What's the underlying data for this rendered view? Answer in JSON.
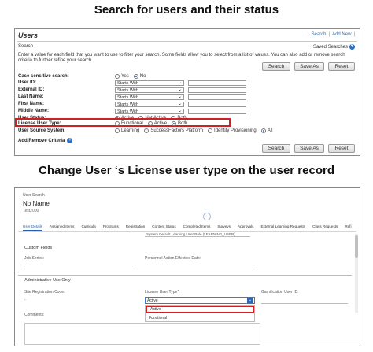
{
  "headings": {
    "top": "Search for users and their status",
    "bottom": "Change User ‘s License user type on the user record"
  },
  "panel1": {
    "title": "Users",
    "toplinks": [
      "Search",
      "Add New"
    ],
    "search_label": "Search",
    "saved_searches_label": "Saved Searches",
    "instructions": "Enter a value for each field that you want to use to filter your search. Some fields allow you to select from a list of values. You can also add or remove search criteria to further refine your search.",
    "buttons": {
      "search": "Search",
      "save_as": "Save As",
      "reset": "Reset"
    },
    "criteria": {
      "case_sensitive": {
        "label": "Case sensitive search:",
        "options": [
          "Yes",
          "No"
        ],
        "selected": "No"
      },
      "user_id": {
        "label": "User ID:",
        "operator": "Starts With"
      },
      "external_id": {
        "label": "External ID:",
        "operator": "Starts With"
      },
      "last_name": {
        "label": "Last Name:",
        "operator": "Starts With"
      },
      "first_name": {
        "label": "First Name:",
        "operator": "Starts With"
      },
      "middle_name": {
        "label": "Middle Name:",
        "operator": "Starts With"
      },
      "user_status": {
        "label": "User Status:",
        "options": [
          "Active",
          "Not Active",
          "Both"
        ],
        "selected": "Active"
      },
      "license_user_type": {
        "label": "License User Type:",
        "options": [
          "Functional",
          "Active",
          "Both"
        ],
        "selected": "Both"
      },
      "user_source_system": {
        "label": "User Source System:",
        "options": [
          "Learning",
          "SuccessFactors Platform",
          "Identity Provisioning",
          "All"
        ],
        "selected": "All"
      }
    },
    "add_remove_label": "Add/Remove Criteria"
  },
  "panel2": {
    "breadcrumb": "User Search",
    "user_name": "No Name",
    "user_id": "Test2000",
    "tabs": [
      "User Details",
      "Assigned Items",
      "Curricula",
      "Programs",
      "Registration",
      "Content Status",
      "Completed Items",
      "Surveys",
      "Approvals",
      "External Learning Requests",
      "Class Requests",
      "Refi"
    ],
    "active_tab": "User Details",
    "partial_field": "System Default Learning User Role (LEARNING_USER)",
    "custom_fields_label": "Custom Fields",
    "job_series_label": "Job Series:",
    "personnel_action_label": "Personnel Action Effective Date:",
    "admin_use_label": "Administrative Use Only",
    "site_reg_code_label": "Site Registration Code:",
    "site_reg_code_value": "-",
    "license_user_type_label": "License User Type*:",
    "license_user_type_value": "Active",
    "license_options": [
      "Active",
      "Functional"
    ],
    "gamification_label": "Gamification User ID:",
    "comments_label": "Comments:"
  }
}
